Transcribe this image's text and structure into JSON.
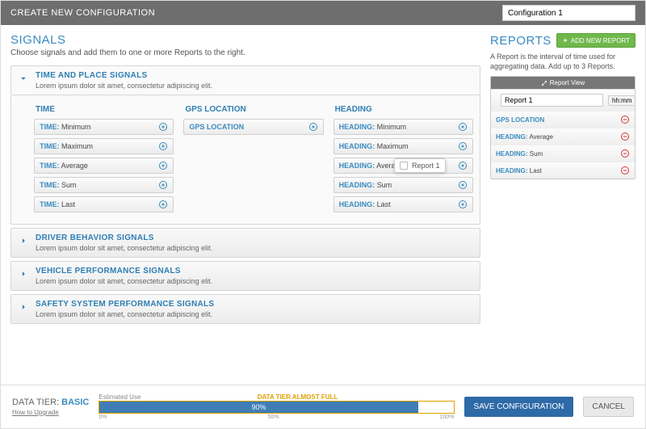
{
  "topbar": {
    "title": "CREATE NEW CONFIGURATION",
    "config_name": "Configuration 1"
  },
  "signals": {
    "title": "SIGNALS",
    "subtitle": "Choose signals and add them to one or more Reports to the right.",
    "groups": [
      {
        "title": "TIME AND PLACE SIGNALS",
        "desc": "Lorem ipsum dolor sit amet, consectetur adipiscing elit.",
        "open": true,
        "columns": [
          {
            "title": "TIME",
            "prefix": "TIME:",
            "items": [
              "Minimum",
              "Maximum",
              "Average",
              "Sum",
              "Last"
            ]
          },
          {
            "title": "GPS LOCATION",
            "prefix": "",
            "items": [
              "GPS LOCATION"
            ]
          },
          {
            "title": "HEADING",
            "prefix": "HEADING:",
            "items": [
              "Minimum",
              "Maximum",
              "Average",
              "Sum",
              "Last"
            ]
          }
        ]
      },
      {
        "title": "DRIVER BEHAVIOR SIGNALS",
        "desc": "Lorem ipsum dolor sit amet, consectetur adipiscing elit.",
        "open": false
      },
      {
        "title": "VEHICLE PERFORMANCE SIGNALS",
        "desc": "Lorem ipsum dolor sit amet, consectetur adipiscing elit.",
        "open": false
      },
      {
        "title": "SAFETY SYSTEM PERFORMANCE SIGNALS",
        "desc": "Lorem ipsum dolor sit amet, consectetur adipiscing elit.",
        "open": false
      }
    ]
  },
  "reports": {
    "title": "REPORTS",
    "add_label": "ADD NEW REPORT",
    "subtitle": "A Report is the interval of time used for aggregating data. Add up to 3 Reports.",
    "view_label": "Report View",
    "report_name": "Report 1",
    "interval_label": "hh:mm",
    "items": [
      {
        "prefix": "",
        "label": "GPS LOCATION"
      },
      {
        "prefix": "HEADING:",
        "label": "Average"
      },
      {
        "prefix": "HEADING:",
        "label": "Sum"
      },
      {
        "prefix": "HEADING:",
        "label": "Last"
      }
    ]
  },
  "ghost": {
    "label": "Report 1"
  },
  "footer": {
    "tier_label": "DATA TIER:",
    "tier_value": "BASIC",
    "upgrade": "How to Upgrade",
    "est_label": "Estimated Use",
    "warn": "DATA TIER ALMOST FULL",
    "fill_pct": 90,
    "fill_text": "90%",
    "ticks": [
      "0%",
      "50%",
      "100%"
    ],
    "save": "SAVE CONFIGURATION",
    "cancel": "CANCEL"
  }
}
